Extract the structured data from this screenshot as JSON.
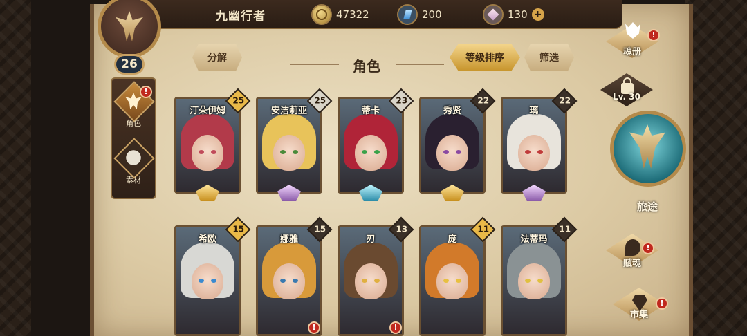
{
  "header": {
    "player_name": "九幽行者",
    "player_level": "26",
    "gold": "47322",
    "crystal": "200",
    "gem": "130",
    "add_symbol": "+"
  },
  "left_nav": [
    {
      "label": "角色",
      "icon": "role-icon",
      "active": true,
      "alert": "!"
    },
    {
      "label": "素材",
      "icon": "material-icon",
      "active": false
    }
  ],
  "toolbar": {
    "decompose_label": "分解",
    "title": "角色",
    "sort_label": "等级排序",
    "filter_label": "筛选"
  },
  "characters": [
    {
      "name": "汀朵伊姆",
      "level": "25",
      "rank": "gold",
      "badge": "gold",
      "hair": "#b23a4a",
      "eye": "#c04a5a",
      "alert": ""
    },
    {
      "name": "安洁莉亚",
      "level": "25",
      "rank": "silver",
      "badge": "silver",
      "hair": "#e8c35a",
      "eye": "#4a8a3a",
      "alert": ""
    },
    {
      "name": "蒂卡",
      "level": "23",
      "rank": "teal",
      "badge": "silver",
      "hair": "#b02438",
      "eye": "#3aa24a",
      "alert": ""
    },
    {
      "name": "秀贤",
      "level": "22",
      "rank": "gold",
      "badge": "dark",
      "hair": "#2a2030",
      "eye": "#8a4aa2",
      "alert": ""
    },
    {
      "name": "璃",
      "level": "22",
      "rank": "silver",
      "badge": "dark",
      "hair": "#e8e4dc",
      "eye": "#c03a3a",
      "alert": ""
    },
    {
      "name": "希欧",
      "level": "15",
      "rank": "silver",
      "badge": "gold",
      "hair": "#d8d8d4",
      "eye": "#3a8ad0",
      "alert": ""
    },
    {
      "name": "娜雅",
      "level": "15",
      "rank": "silver",
      "badge": "dark",
      "hair": "#d89a3a",
      "eye": "#3a7ab0",
      "alert": "!"
    },
    {
      "name": "刃",
      "level": "13",
      "rank": "silver",
      "badge": "dark",
      "hair": "#6a4a30",
      "eye": "#e0b040",
      "alert": "!"
    },
    {
      "name": "庞",
      "level": "11",
      "rank": "silver",
      "badge": "gold",
      "hair": "#d27a2a",
      "eye": "#e8c040",
      "alert": ""
    },
    {
      "name": "法蒂玛",
      "level": "11",
      "rank": "silver",
      "badge": "dark",
      "hair": "#8a9294",
      "eye": "#e0c040",
      "alert": ""
    }
  ],
  "right_menu": {
    "soulbook_label": "魂册",
    "lock_label": "Lv. 30",
    "journey_label": "旅途",
    "talent_label": "赋魂",
    "market_label": "市集",
    "alert": "!"
  }
}
